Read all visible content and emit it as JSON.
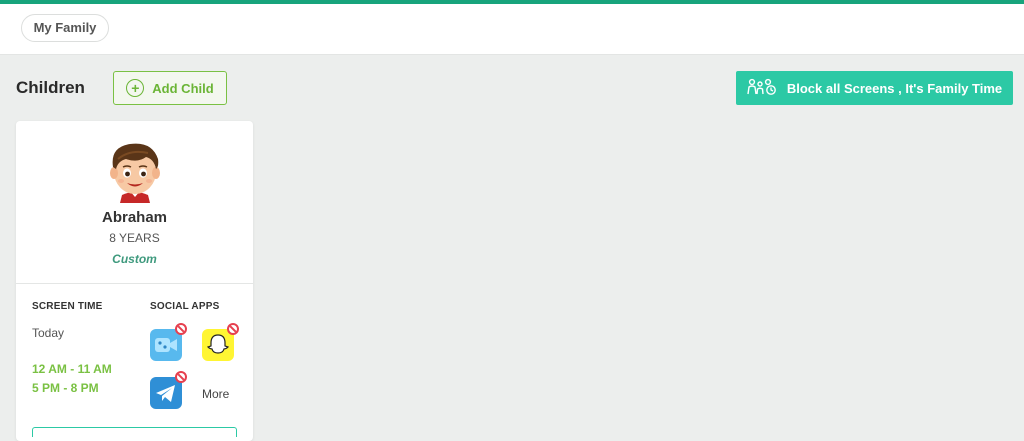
{
  "colors": {
    "accent": "#18a47c",
    "block_button": "#2cc9a5",
    "add_child_green": "#6bb536",
    "time_green": "#7ac143",
    "profile_teal": "#3f9a7e",
    "blocked_red": "#e6404f"
  },
  "header": {
    "tab_label": "My Family"
  },
  "toolbar": {
    "section_title": "Children",
    "add_child_label": "Add Child",
    "add_child_icon": "plus-circle-icon",
    "block_label": "Block all Screens , It's Family Time",
    "block_icon": "family-time-icon"
  },
  "child_card": {
    "avatar_icon": "boy-avatar",
    "name": "Abraham",
    "age": "8 YEARS",
    "profile": "Custom",
    "screen_time": {
      "label": "SCREEN TIME",
      "day": "Today",
      "ranges": [
        "12 AM - 11 AM",
        "5 PM - 8 PM"
      ]
    },
    "social_apps": {
      "label": "SOCIAL APPS",
      "apps": [
        {
          "icon": "video-app-icon",
          "blocked": true
        },
        {
          "icon": "snapchat-icon",
          "blocked": true
        },
        {
          "icon": "telegram-icon",
          "blocked": true
        }
      ],
      "more_label": "More"
    }
  }
}
